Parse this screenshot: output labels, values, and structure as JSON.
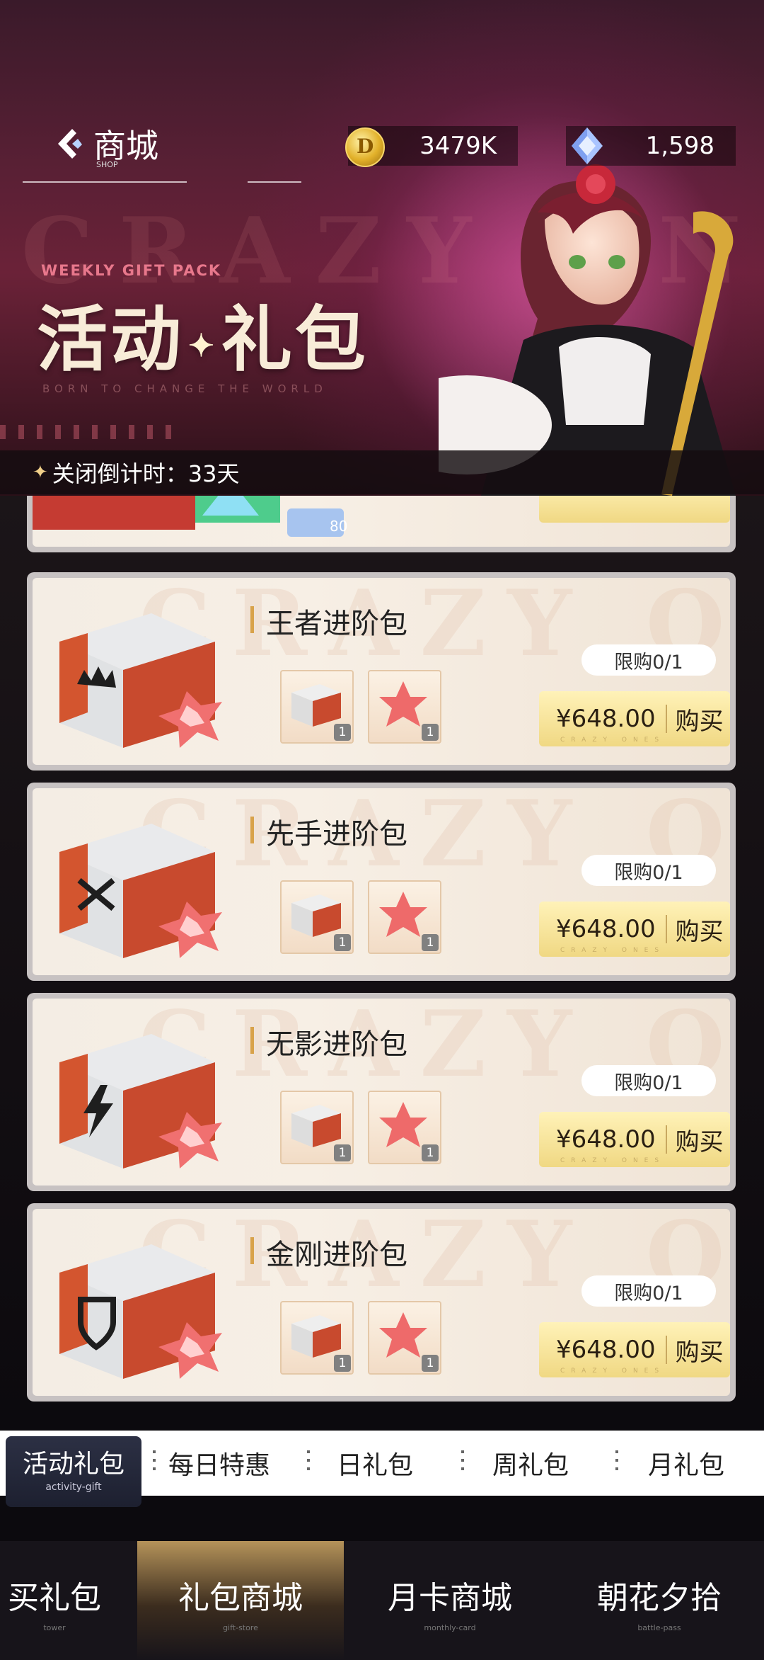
{
  "header": {
    "title": "商城",
    "title_sub": "SHOP",
    "coins": "3479K",
    "diamonds": "1,598"
  },
  "banner": {
    "weekly": "WEEKLY GIFT PACK",
    "headline_a": "活动",
    "headline_b": "礼包",
    "watermark": "CRAZY ONES",
    "tagline": "BORN TO CHANGE THE WORLD",
    "countdown": "关闭倒计时：33天"
  },
  "packs": [
    {
      "name": "王者进阶包",
      "limit": "限购0/1",
      "price": "¥648.00",
      "buy": "购买",
      "qty1": "1",
      "qty2": "1",
      "emblem": "crown-icon"
    },
    {
      "name": "先手进阶包",
      "limit": "限购0/1",
      "price": "¥648.00",
      "buy": "购买",
      "qty1": "1",
      "qty2": "1",
      "emblem": "swords-icon"
    },
    {
      "name": "无影进阶包",
      "limit": "限购0/1",
      "price": "¥648.00",
      "buy": "购买",
      "qty1": "1",
      "qty2": "1",
      "emblem": "lightning-icon"
    },
    {
      "name": "金刚进阶包",
      "limit": "限购0/1",
      "price": "¥648.00",
      "buy": "购买",
      "qty1": "1",
      "qty2": "1",
      "emblem": "shield-icon"
    }
  ],
  "partial_pack": {
    "qty": "80"
  },
  "buy_sub": "CRAZY ONES",
  "subtabs": {
    "active": "活动礼包",
    "active_sub": "activity-gift",
    "items": [
      "每日特惠",
      "日礼包",
      "周礼包",
      "月礼包"
    ]
  },
  "bottomnav": [
    {
      "label": "买礼包",
      "sub": "tower"
    },
    {
      "label": "礼包商城",
      "sub": "gift-store"
    },
    {
      "label": "月卡商城",
      "sub": "monthly-card"
    },
    {
      "label": "朝花夕拾",
      "sub": "battle-pass"
    }
  ]
}
